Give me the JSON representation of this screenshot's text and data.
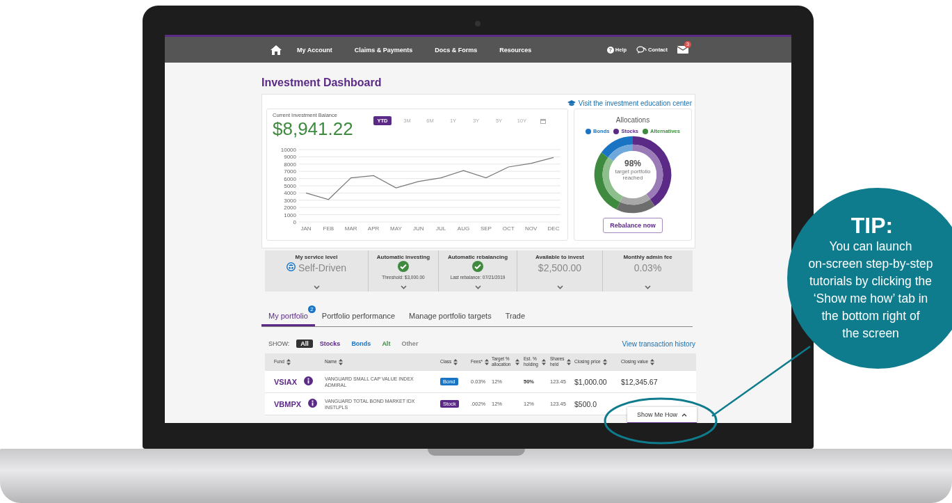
{
  "nav": {
    "links": [
      "My Account",
      "Claims & Payments",
      "Docs & Forms",
      "Resources"
    ],
    "help_icon": "?",
    "help": "Help",
    "contact": "Contact",
    "mail_badge": "3"
  },
  "page_title": "Investment Dashboard",
  "education_link": "Visit the investment education center",
  "balance": {
    "label": "Current Investment Balance",
    "amount": "$8,941.22",
    "periods": [
      {
        "label": "YTD",
        "selected": true
      },
      {
        "label": "3M",
        "selected": false
      },
      {
        "label": "6M",
        "selected": false
      },
      {
        "label": "1Y",
        "selected": false
      },
      {
        "label": "3Y",
        "selected": false
      },
      {
        "label": "5Y",
        "selected": false
      },
      {
        "label": "10Y",
        "selected": false
      }
    ],
    "chart_data": {
      "type": "line",
      "categories": [
        "JAN",
        "FEB",
        "MAR",
        "APR",
        "MAY",
        "JUN",
        "JUL",
        "AUG",
        "SEP",
        "OCT",
        "NOV",
        "DEC"
      ],
      "grid": true,
      "series": [
        {
          "color": "#777777",
          "values": [
            4000,
            3100,
            6100,
            6400,
            4700,
            5600,
            6100,
            7100,
            6100,
            7600,
            8100,
            8900
          ]
        }
      ],
      "ylim": [
        0,
        10000
      ],
      "yticks": [
        0,
        1000,
        2000,
        3000,
        4000,
        5000,
        6000,
        7000,
        8000,
        9000,
        10000
      ]
    }
  },
  "allocations": {
    "title": "Allocations",
    "legend": [
      {
        "label": "Bonds",
        "color": "#1a74c4"
      },
      {
        "label": "Stocks",
        "color": "#5b2a86"
      },
      {
        "label": "Alternatives",
        "color": "#3e8a3e"
      }
    ],
    "center_value": "98%",
    "center_caption": "target portfolio reached",
    "button": "Rebalance now"
  },
  "summary": [
    {
      "kind": "service",
      "label": "My service level",
      "value": "Self-Driven"
    },
    {
      "kind": "check",
      "label": "Automatic investing",
      "note": "Threshold: $3,000.00"
    },
    {
      "kind": "check",
      "label": "Automatic rebalancing",
      "note": "Last rebalance: 07/21/2019"
    },
    {
      "kind": "amount",
      "label": "Available to invest",
      "value": "$2,500.00"
    },
    {
      "kind": "amount",
      "label": "Monthly admin fee",
      "value": "0.03%"
    }
  ],
  "tabs": [
    {
      "label": "My portfolio",
      "selected": true,
      "badge": "2"
    },
    {
      "label": "Portfolio performance",
      "selected": false
    },
    {
      "label": "Manage portfolio targets",
      "selected": false
    },
    {
      "label": "Trade",
      "selected": false
    }
  ],
  "filter": {
    "label": "SHOW:",
    "options": [
      {
        "label": "All",
        "selected": true,
        "color": "#333333"
      },
      {
        "label": "Stocks",
        "selected": false,
        "color": "#5b2a86"
      },
      {
        "label": "Bonds",
        "selected": false,
        "color": "#1a74c4"
      },
      {
        "label": "Alt",
        "selected": false,
        "color": "#3e8a3e"
      },
      {
        "label": "Other",
        "selected": false,
        "color": "#888888"
      }
    ]
  },
  "history_link": "View transaction history",
  "table": {
    "columns": [
      "Fund",
      "Name",
      "Class",
      "Fees*",
      "Target % allocation",
      "Est. % holding",
      "Shares held",
      "Closing price",
      "Closing value"
    ],
    "rows": [
      {
        "cells": [
          {
            "kind": "fund",
            "text": "VSIAX"
          },
          {
            "kind": "name",
            "text": "VANGUARD SMALL CAP VALUE INDEX ADMIRAL"
          },
          {
            "kind": "tag",
            "text": "Bond",
            "color": "#1a74c4"
          },
          {
            "kind": "small",
            "text": "0.03%"
          },
          {
            "kind": "small",
            "text": "12%"
          },
          {
            "kind": "bold",
            "text": "50%"
          },
          {
            "kind": "small",
            "text": "123.45"
          },
          {
            "kind": "large",
            "text": "$1,000.00"
          },
          {
            "kind": "large",
            "text": "$12,345.67"
          }
        ]
      },
      {
        "cells": [
          {
            "kind": "fund",
            "text": "VBMPX"
          },
          {
            "kind": "name",
            "text": "VANGUARD TOTAL BOND MARKET IDX INSTLPLS"
          },
          {
            "kind": "tag",
            "text": "Stock",
            "color": "#5b2a86"
          },
          {
            "kind": "small",
            "text": ".002%"
          },
          {
            "kind": "small",
            "text": "12%"
          },
          {
            "kind": "small",
            "text": "12%"
          },
          {
            "kind": "small",
            "text": "123.45"
          },
          {
            "kind": "large",
            "text": "$500.0"
          }
        ]
      }
    ]
  },
  "show_me_how": "Show Me How",
  "tip": {
    "title": "TIP:",
    "text": "You can launch\non-screen step-by-step\ntutorials by clicking the\n‘Show me how’ tab in\nthe bottom right of\nthe screen"
  }
}
